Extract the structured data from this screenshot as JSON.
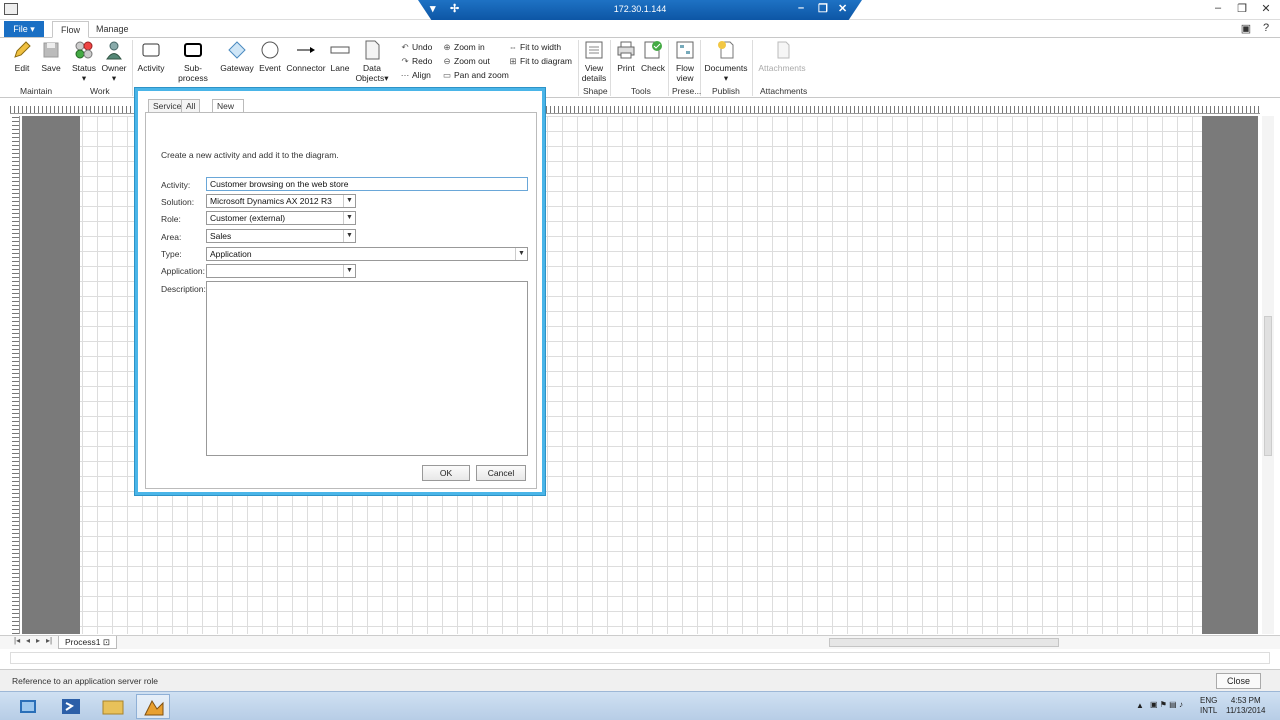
{
  "titlebar": {
    "remote_title": "172.30.1.144",
    "remote_title_right": "...",
    "pin_icon": "pin-icon"
  },
  "tabs": {
    "file": "File",
    "items": [
      "Flow",
      "Manage"
    ]
  },
  "ribbon": {
    "buttons": {
      "edit": "Edit",
      "save": "Save",
      "status": "Status",
      "owner": "Owner",
      "activity": "Activity",
      "subprocess": "Sub-process",
      "gateway": "Gateway",
      "event": "Event",
      "connector": "Connector",
      "lane": "Lane",
      "data_objects": "Data Objects",
      "view_details": "View details",
      "print": "Print",
      "check": "Check",
      "flow_view": "Flow view",
      "documents": "Documents",
      "attachments": "Attachments"
    },
    "small": {
      "undo": "Undo",
      "redo": "Redo",
      "align": "Align",
      "zoom_in": "Zoom in",
      "zoom_out": "Zoom out",
      "pan_zoom": "Pan and zoom",
      "fit_width": "Fit to width",
      "fit_diagram": "Fit to diagram"
    },
    "groups": {
      "maintain": "Maintain",
      "work": "Work",
      "shape": "Shape",
      "tools": "Tools",
      "presentation": "Prese...",
      "publish": "Publish",
      "attachments": "Attachments"
    }
  },
  "dialog": {
    "tabs": [
      "Service",
      "All",
      "New"
    ],
    "active_tab": "New",
    "intro": "Create a new activity and add it to the diagram.",
    "labels": {
      "activity": "Activity:",
      "solution": "Solution:",
      "role": "Role:",
      "area": "Area:",
      "type": "Type:",
      "application": "Application:",
      "description": "Description:"
    },
    "values": {
      "activity": "Customer browsing on the web store",
      "solution": "Microsoft Dynamics AX 2012 R3",
      "role": "Customer (external)",
      "area": "Sales",
      "type": "Application",
      "application": "",
      "description": ""
    },
    "ok": "OK",
    "cancel": "Cancel"
  },
  "sheet": {
    "tab_name": "Process1"
  },
  "status": {
    "text": "Reference to an application server role",
    "close": "Close"
  },
  "taskbar": {
    "lang": "ENG",
    "lang2": "INTL",
    "time": "4:53 PM",
    "date": "11/13/2014"
  },
  "colors": {
    "accent": "#1a6fc4",
    "dialog_border": "#4ab5e8"
  }
}
